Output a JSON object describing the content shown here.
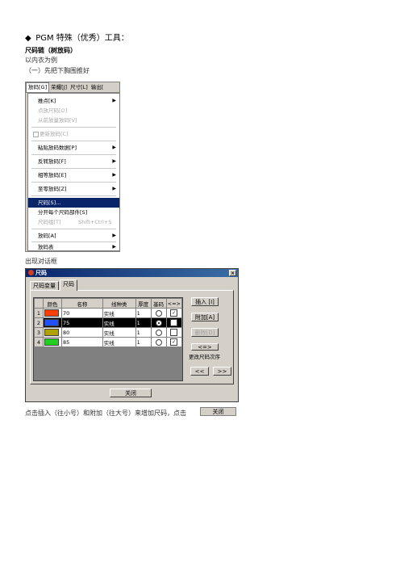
{
  "doc": {
    "heading": "PGM 特殊（优秀）工具：",
    "bullet": "◆",
    "subheading": "尺码链（树放码）",
    "line1": "以内衣为例",
    "line2": "（一）先把下胸围推好",
    "dialog_intro": "出现对话框",
    "final_line": "点击插入（往小号）和附加（往大号）来增加尺码，点击"
  },
  "menu": {
    "menubar": [
      "放码[G]",
      "荣耀[J]",
      "尺寸[L]",
      "输出["
    ],
    "items": [
      {
        "label": "推点[K]",
        "arrow": true,
        "disabled": false
      },
      {
        "label": "点放尺码[O]",
        "arrow": false,
        "disabled": true
      },
      {
        "label": "从前放量放码[V]",
        "arrow": false,
        "disabled": true
      },
      {
        "label": "更新放码[C]",
        "arrow": false,
        "disabled": true,
        "icon": true
      },
      {
        "label": "粘贴放码数据[P]",
        "arrow": true,
        "disabled": false
      },
      {
        "label": "反转放码[F]",
        "arrow": true,
        "disabled": false
      },
      {
        "label": "相等放码[E]",
        "arrow": true,
        "disabled": false
      },
      {
        "label": "至零放码[Z]",
        "arrow": true,
        "disabled": false
      },
      {
        "label": "尺码[S]...",
        "arrow": false,
        "disabled": false,
        "highlight": true
      },
      {
        "label": "分开每个尺码部件[S]",
        "arrow": false,
        "disabled": false
      },
      {
        "label": "尺码组[T]",
        "arrow": false,
        "disabled": true,
        "shortcut": "Shift+Ctrl+S"
      },
      {
        "label": "放码[A]",
        "arrow": true,
        "disabled": false
      },
      {
        "label": "放码表",
        "arrow": true,
        "disabled": false
      }
    ]
  },
  "dialog": {
    "title": "尺码",
    "close_x": "×",
    "tabs": [
      "尺码变量",
      "尺码"
    ],
    "columns": [
      "颜色",
      "名称",
      "线种类",
      "厚度",
      "基码",
      "<=>"
    ],
    "rows": [
      {
        "num": "1",
        "color": "#ff4000",
        "name": "70",
        "line": "实线",
        "thick": "1",
        "base": false,
        "chk": true
      },
      {
        "num": "2",
        "color": "#2050ff",
        "name": "75",
        "line": "实线",
        "thick": "1",
        "base": true,
        "chk": true
      },
      {
        "num": "3",
        "color": "#b0a000",
        "name": "80",
        "line": "实线",
        "thick": "1",
        "base": false,
        "chk": false
      },
      {
        "num": "4",
        "color": "#20d020",
        "name": "85",
        "line": "实线",
        "thick": "1",
        "base": false,
        "chk": true
      }
    ],
    "btn_insert": "插入 [I]",
    "btn_append": "附加[A]",
    "btn_delete": "删除[D]",
    "arrow_label": "<=>",
    "order_label": "更改尺码次序",
    "btn_prev": "<<",
    "btn_next": ">>",
    "btn_close": "关闭",
    "check_mark": "✓"
  },
  "close_button_inline": "关闭"
}
